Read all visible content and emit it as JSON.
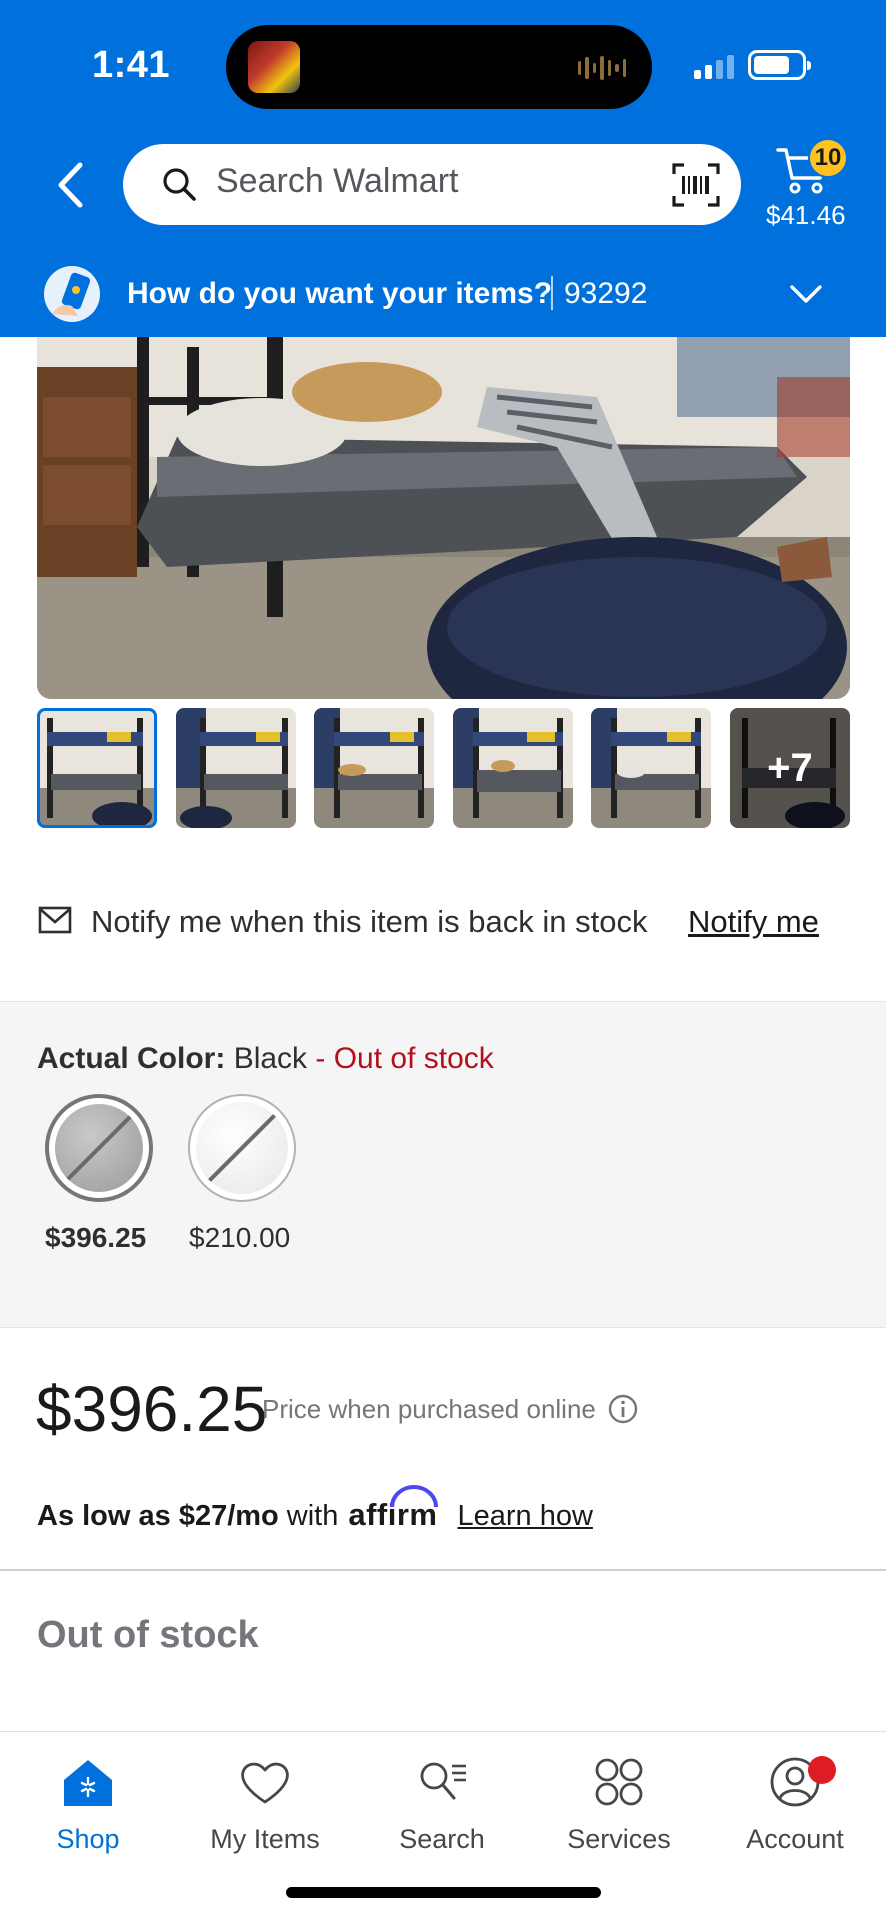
{
  "status_bar": {
    "time": "1:41"
  },
  "header": {
    "search_placeholder": "Search Walmart",
    "cart_count": "10",
    "cart_total": "$41.46",
    "fulfillment_question": "How do you want your items?",
    "zip": "93292"
  },
  "gallery": {
    "more_count": "+7"
  },
  "notify": {
    "text": "Notify me when this item is back in stock",
    "link": "Notify me"
  },
  "variant": {
    "label": "Actual Color:",
    "value": "Black",
    "status": "- Out of stock",
    "options": [
      {
        "price": "$396.25"
      },
      {
        "price": "$210.00"
      }
    ]
  },
  "pricing": {
    "price": "$396.25",
    "note": "Price when purchased online",
    "affirm_prefix": "As low as $27/mo",
    "affirm_with": "with",
    "affirm_brand": "affirm",
    "affirm_learn": "Learn how"
  },
  "availability": {
    "label": "Out of stock"
  },
  "bottom_nav": {
    "items": [
      {
        "label": "Shop"
      },
      {
        "label": "My Items"
      },
      {
        "label": "Search"
      },
      {
        "label": "Services"
      },
      {
        "label": "Account"
      }
    ]
  },
  "colors": {
    "brand_blue": "#0071dc",
    "spark_yellow": "#ffc220",
    "out_of_stock_red": "#b3101e",
    "notification_red": "#de1c24"
  }
}
